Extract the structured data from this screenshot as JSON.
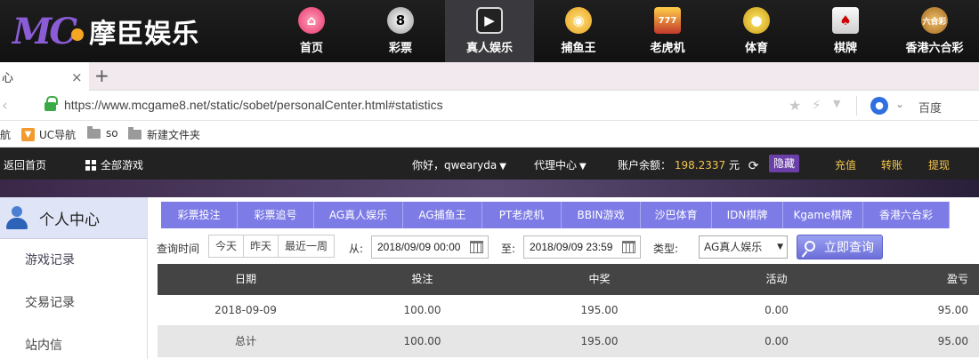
{
  "site": {
    "logo_mark": "MC",
    "logo_text": "摩臣娱乐",
    "nav": [
      {
        "label": "首页",
        "icon": "home-icon",
        "glyph": "⌂"
      },
      {
        "label": "彩票",
        "icon": "lottery-ball-icon",
        "glyph": "8"
      },
      {
        "label": "真人娱乐",
        "icon": "live-casino-icon",
        "glyph": "▶",
        "active": true
      },
      {
        "label": "捕鱼王",
        "icon": "fish-icon",
        "glyph": "◉"
      },
      {
        "label": "老虎机",
        "icon": "slot-machine-icon",
        "glyph": "777"
      },
      {
        "label": "体育",
        "icon": "sports-icon",
        "glyph": "●"
      },
      {
        "label": "棋牌",
        "icon": "cards-icon",
        "glyph": "♠"
      },
      {
        "label": "香港六合彩",
        "icon": "hk-lottery-icon",
        "glyph": "六合彩"
      }
    ]
  },
  "browser": {
    "tab_title": "心",
    "close_glyph": "×",
    "new_tab_glyph": "+",
    "url": "https://www.mcgame8.net/static/sobet/personalCenter.html#statistics",
    "search_engine": "百度",
    "bookmarks": [
      {
        "label": "航",
        "icon": ""
      },
      {
        "label": "UC导航",
        "icon": "uc-icon"
      },
      {
        "label": "so",
        "icon": "folder-icon"
      },
      {
        "label": "新建文件夹",
        "icon": "folder-icon"
      }
    ]
  },
  "toolbar": {
    "home": "返回首页",
    "all_games": "全部游戏",
    "greeting": "你好，qwearyda",
    "agent": "代理中心",
    "balance_label": "账户余额：",
    "balance_value": "198.2337",
    "balance_unit": "元",
    "hide": "隐藏",
    "recharge": "充值",
    "transfer": "转账",
    "withdraw": "提现"
  },
  "sidebar": {
    "title": "个人中心",
    "items": [
      "游戏记录",
      "交易记录",
      "站内信"
    ]
  },
  "tabs": [
    {
      "label": "彩票投注",
      "w": 86
    },
    {
      "label": "彩票追号",
      "w": 86
    },
    {
      "label": "AG真人娱乐",
      "w": 100
    },
    {
      "label": "AG捕鱼王",
      "w": 89
    },
    {
      "label": "PT老虎机",
      "w": 89
    },
    {
      "label": "BBIN游戏",
      "w": 89
    },
    {
      "label": "沙巴体育",
      "w": 80
    },
    {
      "label": "IDN棋牌",
      "w": 80
    },
    {
      "label": "Kgame棋牌",
      "w": 90
    },
    {
      "label": "香港六合彩",
      "w": 97
    }
  ],
  "filter": {
    "label": "查询时间",
    "quick": [
      "今天",
      "昨天",
      "最近一周"
    ],
    "from_label": "从:",
    "from_value": "2018/09/09 00:00",
    "to_label": "至:",
    "to_value": "2018/09/09 23:59",
    "type_label": "类型:",
    "type_value": "AG真人娱乐",
    "query_button": "立即查询"
  },
  "table": {
    "headers": [
      "日期",
      "投注",
      "中奖",
      "活动",
      "盈亏"
    ],
    "rows": [
      [
        "2018-09-09",
        "100.00",
        "195.00",
        "0.00",
        "95.00"
      ]
    ],
    "total": [
      "总计",
      "100.00",
      "195.00",
      "0.00",
      "95.00"
    ]
  },
  "colors": {
    "tab_purple": "#7d7be6",
    "balance_gold": "#f3c54b",
    "hide_purple": "#6a3fa8"
  }
}
